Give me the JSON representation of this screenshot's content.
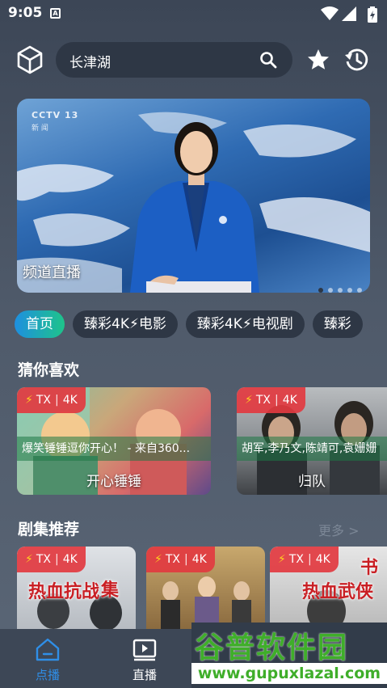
{
  "status_bar": {
    "time": "9:05",
    "notification_glyph": "A"
  },
  "header": {
    "search_text": "长津湖",
    "icons": [
      "cube-icon",
      "search-icon",
      "star-icon",
      "history-icon"
    ]
  },
  "banner": {
    "logo": "CCTV 13",
    "logo_sub": "新 闻",
    "caption": "频道直播",
    "page_count": 5,
    "active_page": 1
  },
  "tabs": [
    {
      "label": "首页",
      "active": true
    },
    {
      "label": "臻彩4K⚡电影",
      "active": false
    },
    {
      "label": "臻彩4K⚡电视剧",
      "active": false
    },
    {
      "label": "臻彩",
      "active": false
    }
  ],
  "section_guess": {
    "title": "猜你喜欢",
    "cards": [
      {
        "badge_bolt": "⚡",
        "badge_source": "TX",
        "badge_quality": "4K",
        "subtitle": "爆笑锤锤逗你开心！ - 来自360...",
        "title": "开心锤锤"
      },
      {
        "badge_bolt": "⚡",
        "badge_source": "TX",
        "badge_quality": "4K",
        "subtitle": "胡军,李乃文,陈靖可,袁姗姗",
        "title": "归队"
      }
    ]
  },
  "section_series": {
    "title": "剧集推荐",
    "more": "更多 >",
    "cards": [
      {
        "badge_bolt": "⚡",
        "badge_source": "TX",
        "badge_quality": "4K",
        "poster_text_1": "集",
        "poster_text_2": "热血抗战"
      },
      {
        "badge_bolt": "⚡",
        "badge_source": "TX",
        "badge_quality": "4K"
      },
      {
        "badge_bolt": "⚡",
        "badge_source": "TX",
        "badge_quality": "4K",
        "poster_text_1": "书",
        "poster_text_2": "热血武侠"
      }
    ]
  },
  "bottom_nav": [
    {
      "label": "点播",
      "icon": "home-icon",
      "active": true,
      "color": "#2f8fe8"
    },
    {
      "label": "直播",
      "icon": "play-icon",
      "active": false,
      "color": "#ffffff"
    }
  ],
  "watermark": {
    "big": "谷普软件园",
    "small": "www.gupuxlazal.com"
  }
}
